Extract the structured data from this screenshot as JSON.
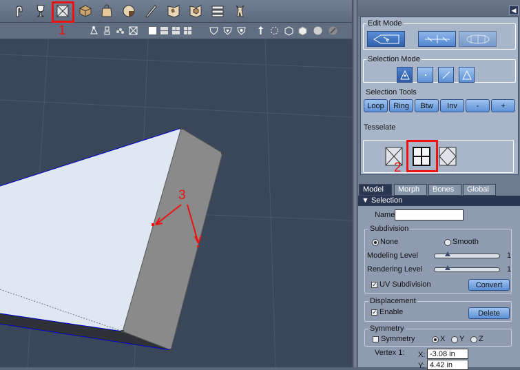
{
  "toolbar": {
    "icons": [
      "cursor-hand-icon",
      "trophy-icon",
      "wireframe-box-icon",
      "cube-icon",
      "bag-icon",
      "sphere-icon",
      "knife-icon",
      "map-flag-icon",
      "map-cube-icon",
      "grid-align-icon",
      "figure-icon"
    ]
  },
  "viewbar": {
    "icons": [
      "camera-axis-icon",
      "light-icon",
      "group-icon",
      "origin-icon",
      "single-view-icon",
      "two-view-icon",
      "three-view-icon",
      "four-view-icon",
      "shield-a-icon",
      "shield-b-icon",
      "shield-c-icon",
      "move-icon",
      "rotate-icon",
      "box-shade-icon",
      "cube-shade-icon",
      "sphere-gray-icon",
      "sphere-dark-icon"
    ]
  },
  "panel": {
    "edit_mode": {
      "title": "Edit Mode",
      "buttons": [
        "select-mode",
        "transform-mode",
        "morph-mode"
      ]
    },
    "selection_mode": {
      "title": "Selection Mode",
      "buttons": [
        "polygon-select",
        "vertex-select",
        "edge-select",
        "face-select"
      ]
    },
    "selection_tools": {
      "title": "Selection Tools",
      "buttons": [
        "Loop",
        "Ring",
        "Btw",
        "Inv",
        "-",
        "+"
      ]
    },
    "tesselate": {
      "title": "Tesselate",
      "buttons": [
        "tesselate-cross",
        "tesselate-quad",
        "tesselate-diamond"
      ]
    },
    "tabs": [
      "Model",
      "Morph",
      "Bones",
      "Global"
    ],
    "active_tab": "Model",
    "selection": {
      "header": "Selection",
      "name_label": "Name",
      "name_value": "",
      "subdivision": {
        "title": "Subdivision",
        "none_label": "None",
        "smooth_label": "Smooth",
        "selected": "None",
        "modeling_label": "Modeling Level",
        "modeling_value": "1",
        "modeling_fraction": 0.2,
        "rendering_label": "Rendering Level",
        "rendering_value": "1",
        "rendering_fraction": 0.2,
        "uv_label": "UV Subdivision",
        "uv_checked": true,
        "convert_label": "Convert"
      },
      "displacement": {
        "title": "Displacement",
        "enable_label": "Enable",
        "enable_checked": true,
        "delete_label": "Delete"
      },
      "symmetry": {
        "title": "Symmetry",
        "symmetry_label": "Symmetry",
        "symmetry_checked": false,
        "x_label": "X",
        "y_label": "Y",
        "z_label": "Z",
        "axis_selected": "X",
        "vertex1_label": "Vertex 1:",
        "x_field_label": "X:",
        "x_value": "-3.08 in",
        "y_field_label": "Y:",
        "y_value": "4.42 in"
      }
    }
  },
  "annotations": {
    "one": "1",
    "two": "2",
    "three": "3",
    "color": "#ee1111"
  }
}
